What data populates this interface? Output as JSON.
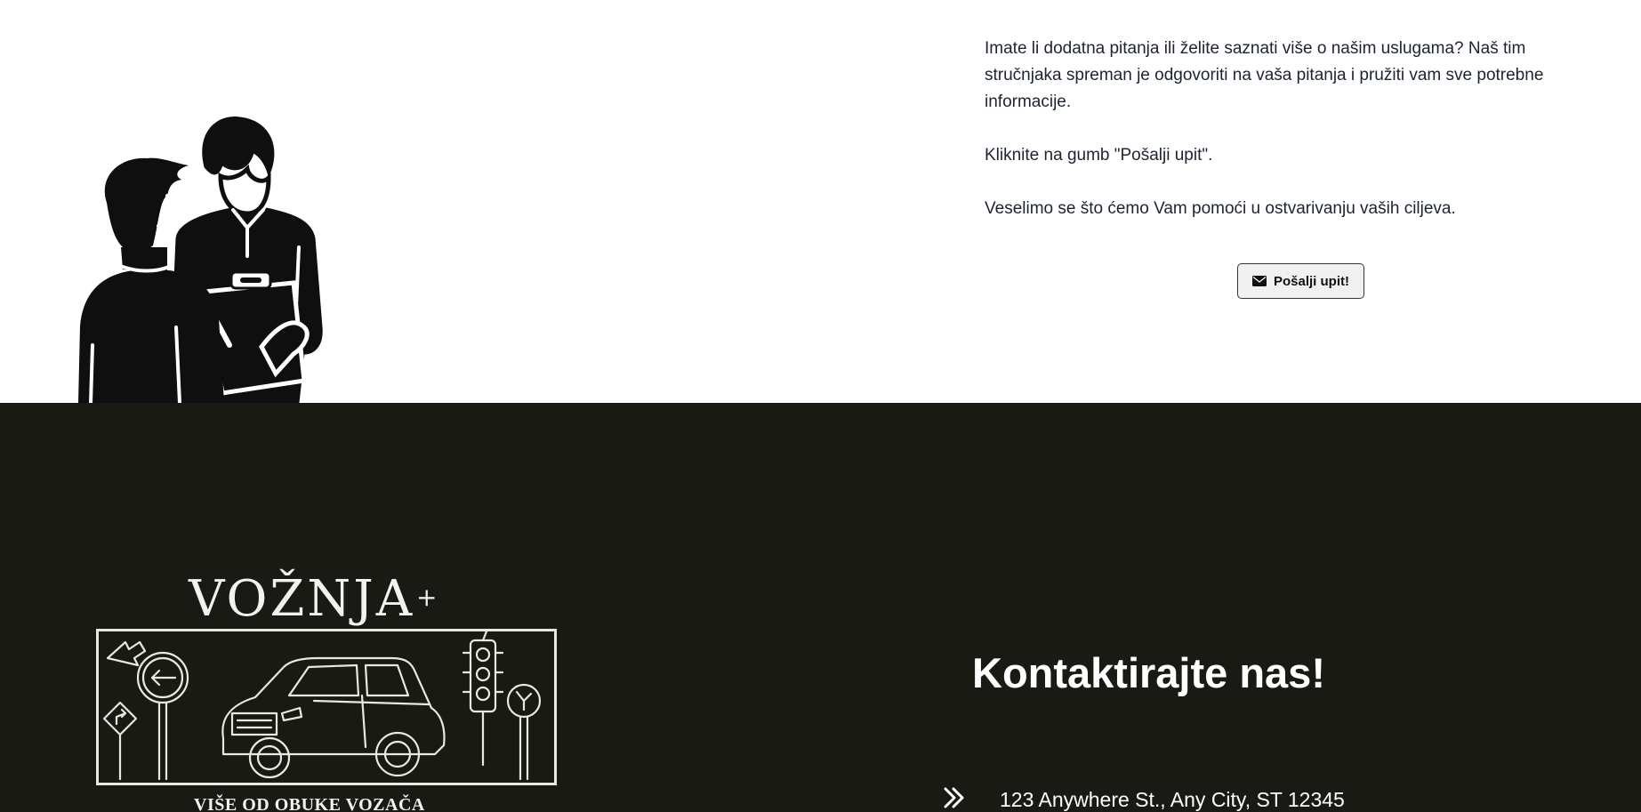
{
  "info": {
    "paragraph_1": "Imate li dodatna pitanja ili želite saznati više o našim uslugama? Naš tim stručnjaka spreman je odgovoriti na vaša pitanja i pružiti vam sve potrebne informacije.",
    "paragraph_2": "Kliknite na gumb \"Pošalji upit\".",
    "paragraph_3": "Veselimo se što ćemo Vam pomoći u ostvarivanju vaših ciljeva.",
    "button_label": "Pošalji upit!",
    "button_icon": "envelope-icon"
  },
  "illustration": {
    "icon": "consultation-illustration"
  },
  "footer": {
    "logo": {
      "title": "VOŽNJA",
      "plus": "+",
      "tagline": "VIŠE OD OBUKE VOZAČA"
    },
    "contact_title": "Kontaktirajte nas!",
    "contact_items": [
      {
        "icon": "double-chevron-right-icon",
        "text": "123 Anywhere St., Any City, ST 12345"
      }
    ]
  },
  "colors": {
    "footer_background": "#1a1a14",
    "text_dark": "#1c2430",
    "text_light": "#ffffff",
    "button_background": "#f1f1f1"
  }
}
